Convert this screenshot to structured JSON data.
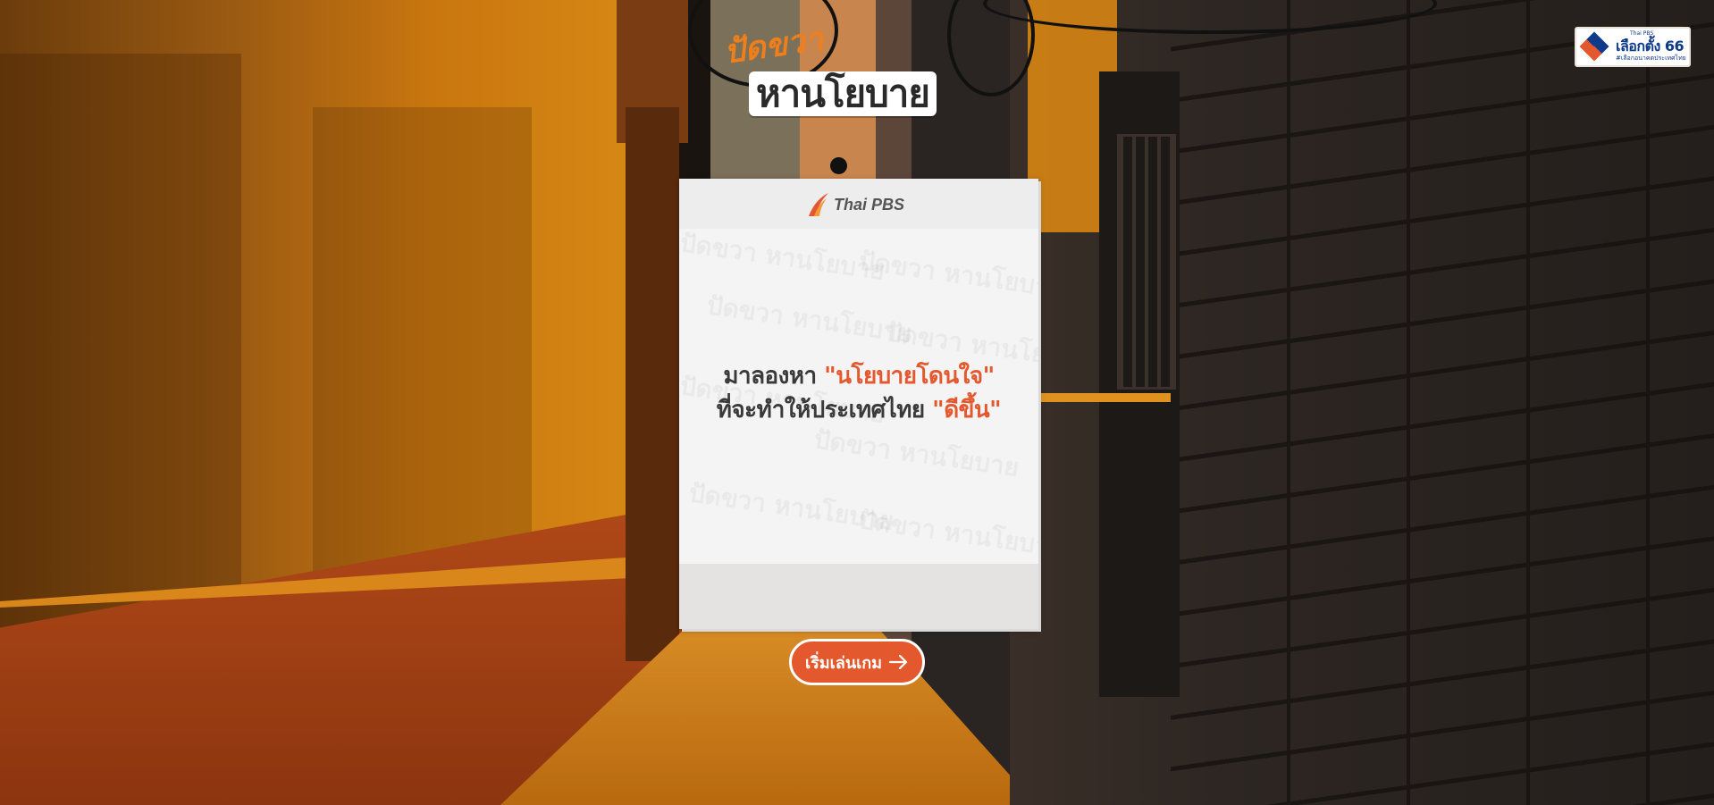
{
  "show_logo": {
    "line1": "ปัดขวา",
    "line2": "หานโยบาย"
  },
  "election_badge": {
    "small": "Thai PBS",
    "title": "เลือกตั้ง 66",
    "subtitle": "#เลือกอนาคตประเทศไทย"
  },
  "card": {
    "brand": "Thai PBS",
    "watermark": "ปัดขวา หานโยบาย",
    "line1_prefix": "มาลองหา ",
    "line1_highlight": "\"นโยบายโดนใจ\"",
    "line2_prefix": "ที่จะทำให้ประเทศไทย ",
    "line2_highlight": "\"ดีขึ้น\""
  },
  "start_button": {
    "label": "เริ่มเล่นเกม"
  },
  "colors": {
    "accent": "#e4582e",
    "logo_orange": "#ee7f1a",
    "badge_blue": "#0e3a8a"
  },
  "icons": {
    "start": "arrow-right-icon",
    "brand": "thai-pbs-logo",
    "badge": "election-diamond-logo"
  }
}
